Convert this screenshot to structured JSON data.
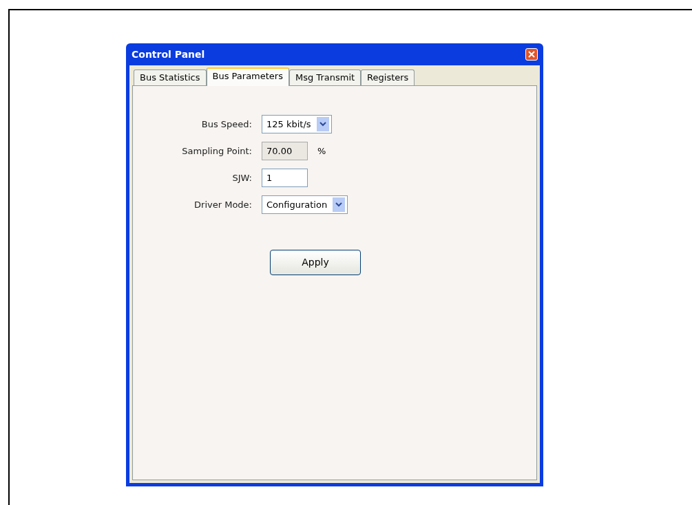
{
  "window": {
    "title": "Control Panel"
  },
  "tabs": [
    {
      "label": "Bus Statistics",
      "selected": false
    },
    {
      "label": "Bus Parameters",
      "selected": true
    },
    {
      "label": "Msg Transmit",
      "selected": false
    },
    {
      "label": "Registers",
      "selected": false
    }
  ],
  "fields": [
    {
      "label": "Bus Speed:",
      "kind": "dropdown",
      "value": "125 kbit/s"
    },
    {
      "label": "Sampling Point:",
      "kind": "readonly",
      "value": "70.00",
      "unit": "%"
    },
    {
      "label": "SJW:",
      "kind": "text",
      "value": "1"
    },
    {
      "label": "Driver Mode:",
      "kind": "dropdown",
      "value": "Configuration"
    }
  ],
  "buttons": [
    "Apply"
  ]
}
